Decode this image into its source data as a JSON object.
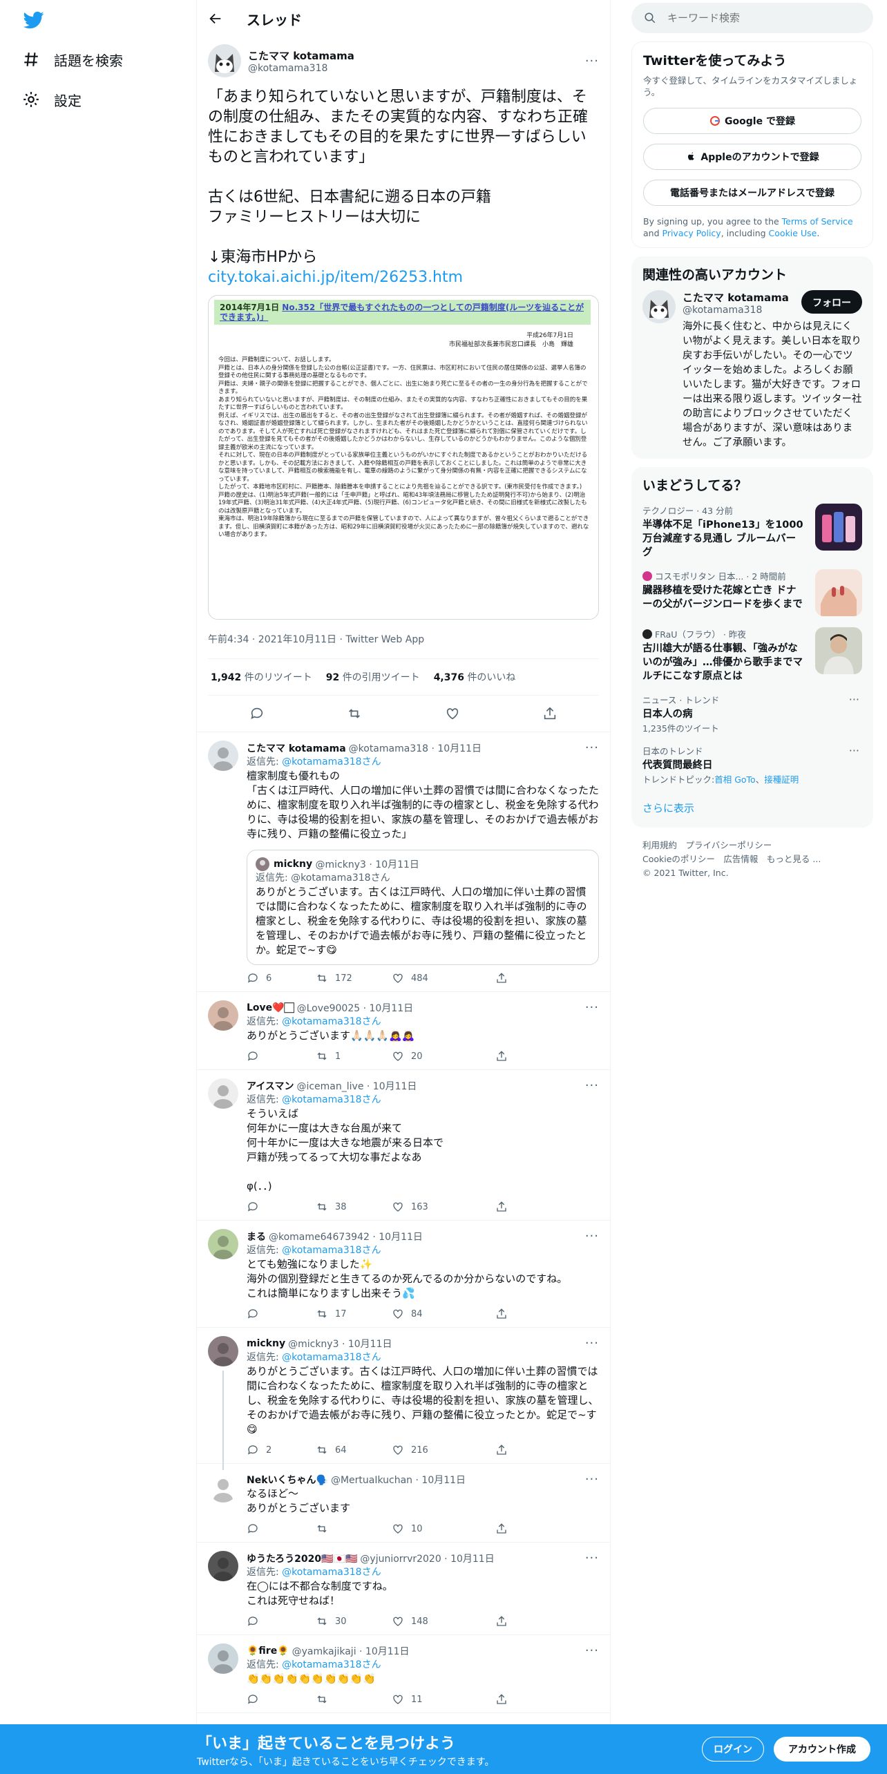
{
  "nav": {
    "explore": "話題を検索",
    "settings": "設定"
  },
  "header": {
    "title": "スレッド"
  },
  "focal": {
    "name": "こたママ kotamama",
    "handle": "@kotamama318",
    "text": "「あまり知られていないと思いますが、戸籍制度は、その制度の仕組み、またその実質的な内容、すなわち正確性におきましてもその目的を果たすに世界一すばらしいものと言われています」\n\n古くは6世紀、日本書紀に遡る日本の戸籍\nファミリーヒストリーは大切に\n\n↓東海市HPから",
    "link": "city.tokai.aichi.jp/item/26253.htm",
    "doc_banner_date": "2014年7月1日",
    "doc_banner_link": "No.352「世界で最もすぐれたものの一つとしての戸籍制度(ルーツを辿ることができます。)」",
    "doc_date": "平成26年7月1日",
    "doc_author": "市民福祉部次長兼市民窓口課長　小島　輝雄",
    "doc_body": "今回は、戸籍制度について、お話しします。\n戸籍とは、日本人の身分関係を登録した公の台帳(公正証書)です。一方、住民票は、市区町村において住民の居住関係の公証、選挙人名簿の登録その他住民に関する事務処理の基礎となるものです。\n戸籍は、夫婦・親子の関係を登録に把握することができ、個人ごとに、出生に始まり死亡に至るその者の一生の身分行為を把握することができます。\nあまり知られていないと思いますが、戸籍制度は、その制度の仕組み、またその実質的な内容、すなわち正確性におきましてもその目的を果たすに世界一すばらしいものと言われています。\n例えば、イギリスでは、出生の届出をすると、その者の出生登録がなされて出生登録簿に綴られます。その者が婚姻すれば、その婚姻登録がなされ、婚姻証書が婚姻登録簿として綴られます。しかし、生まれた者がその後婚姻したかどうかということは、直接何ら関連づけられないのであります。そして人が死亡すれば死亡登録がなされますけれども、それはまた死亡登録簿に綴られて別個に保管されていくだけです。したがって、出生登録を見てもその者がその後婚姻したかどうかはわからないし、生存しているのかどうかもわかりません。このような個別登録主義が欧米の主流になっています。\nそれに対して、現在の日本の戸籍制度がとっている家族単位主義というものがいかにすぐれた制度であるかということがおわかりいただけるかと思います。しかも、その記載方法におきまして、入籍や除籍相互の戸籍を表示しておくことにしました。これは簡単のようで非常に大きな意味を持っていまして、戸籍相互の検索機能を有し、電車の線路のように繋がって身分関係の有無・内容を正確に把握できるシステムになっています。\nしたがって、本籍地市区町村に、戸籍謄本、除籍謄本を申請することにより先祖を辿ることができる訳です。(東市民受付を作成できます。)\n戸籍の歴史は、(1)明治5年式戸籍(一般的には「壬申戸籍」と呼ばれ、昭和43年頃法務局に移管したため証明発行不可)から始まり、(2)明治19年式戸籍、(3)明治31年式戸籍、(4)大正4年式戸籍、(5)現行戸籍、(6)コンピュータ化戸籍と続き、その間に旧様式を新様式に改製したものは改製原戸籍となっています。\n東海市は、明治19年除籍簿から現在に至るまでの戸籍を保管していますので、人によって異なりますが、曾々祖父くらいまで遡ることができます。但し、旧横須賀町に本籍があった方は、昭和29年に旧横須賀町役場が火災にあったために一部の除籍簿が焼失していますので、遡れない場合があります。",
    "timestamp": "午前4:34 · 2021年10月11日 · Twitter Web App",
    "retweets_num": "1,942",
    "retweets_label": "件のリツイート",
    "quotes_num": "92",
    "quotes_label": "件の引用ツイート",
    "likes_num": "4,376",
    "likes_label": "件のいいね"
  },
  "replies": [
    {
      "name": "こたママ kotamama",
      "meta": "@kotamama318 · 10月11日",
      "replyto_prefix": "返信先: ",
      "replyto": "@kotamama318さん",
      "text": "檀家制度も優れもの\n「古くは江戸時代、人口の増加に伴い土葬の習慣では間に合わなくなったために、檀家制度を取り入れ半ば強制的に寺の檀家とし、税金を免除する代わりに、寺は役場的役割を担い、家族の墓を管理し、そのおかげで過去帳がお寺に残り、戸籍の整備に役立った」",
      "quote": {
        "name": "mickny",
        "meta": "@mickny3 · 10月11日",
        "replyto": "返信先: @kotamama318さん",
        "text": "ありがとうございます。古くは江戸時代、人口の増加に伴い土葬の習慣では間に合わなくなったために、檀家制度を取り入れ半ば強制的に寺の檀家とし、税金を免除する代わりに、寺は役場的役割を担い、家族の墓を管理し、そのおかげで過去帳がお寺に残り、戸籍の整備に役立ったとか。蛇足で~す😋"
      },
      "replies": "6",
      "retweets": "172",
      "likes": "484"
    },
    {
      "name": "Love❤️🏻",
      "meta": "@Love90025 · 10月11日",
      "replyto_prefix": "返信先: ",
      "replyto": "@kotamama318さん",
      "text": "ありがとうございます🙏🏻🙏🏻🙏🏻🙇‍♀️🙇‍♀️",
      "replies": "",
      "retweets": "1",
      "likes": "20"
    },
    {
      "name": "アイスマン",
      "meta": "@iceman_live · 10月11日",
      "replyto_prefix": "返信先: ",
      "replyto": "@kotamama318さん",
      "text": "そういえば\n何年かに一度は大きな台風が来て\n何十年かに一度は大きな地震が来る日本で\n戸籍が残ってるって大切な事だよなあ\n\nφ(．．)",
      "replies": "",
      "retweets": "38",
      "likes": "163"
    },
    {
      "name": "まる",
      "meta": "@komame64673942 · 10月11日",
      "replyto_prefix": "返信先: ",
      "replyto": "@kotamama318さん",
      "text": "とても勉強になりました✨\n海外の個別登録だと生きてるのか死んでるのか分からないのですね。\nこれは簡単になりますし出来そう💦",
      "replies": "",
      "retweets": "17",
      "likes": "84"
    },
    {
      "name": "mickny",
      "meta": "@mickny3 · 10月11日",
      "replyto_prefix": "返信先: ",
      "replyto": "@kotamama318さん",
      "text": "ありがとうございます。古くは江戸時代、人口の増加に伴い土葬の習慣では間に合わなくなったために、檀家制度を取り入れ半ば強制的に寺の檀家とし、税金を免除する代わりに、寺は役場的役割を担い、家族の墓を管理し、そのおかげで過去帳がお寺に残り、戸籍の整備に役立ったとか。蛇足で~す😋",
      "replies": "2",
      "retweets": "64",
      "likes": "216"
    },
    {
      "name": "Nekいくちゃん🗣️",
      "meta": "@MertuaIkuchan · 10月11日",
      "replyto_prefix": "",
      "replyto": "",
      "text": "なるほど〜\nありがとうございます",
      "replies": "",
      "retweets": "",
      "likes": "10"
    },
    {
      "name": "ゆうたろう2020🇺🇸🇯🇵🇺🇸",
      "meta": "@yjuniorrvr2020 · 10月11日",
      "replyto_prefix": "返信先: ",
      "replyto": "@kotamama318さん",
      "text": "在◯には不都合な制度ですね。\nこれは死守せねば！",
      "replies": "",
      "retweets": "30",
      "likes": "148"
    },
    {
      "name": "🌻fire🌻",
      "meta": "@yamkajikaji · 10月11日",
      "replyto_prefix": "返信先: ",
      "replyto": "@kotamama318さん",
      "text": "👏👏👏👏👏👏👏👏👏👏",
      "replies": "",
      "retweets": "",
      "likes": "11"
    }
  ],
  "right": {
    "search_placeholder": "キーワード検索",
    "signup_title": "Twitterを使ってみよう",
    "signup_sub": "今すぐ登録して、タイムラインをカスタマイズしましょう。",
    "google_btn": "Google で登録",
    "apple_btn": "Appleのアカウントで登録",
    "phone_btn": "電話番号またはメールアドレスで登録",
    "terms_1": "By signing up, you agree to the ",
    "terms_link1": "Terms of Service",
    "terms_2": " and ",
    "terms_link2": "Privacy Policy",
    "terms_3": ", including ",
    "terms_link3": "Cookie Use",
    "terms_4": ".",
    "related_title": "関連性の高いアカウント",
    "related_name": "こたママ kotamama",
    "related_handle": "@kotamama318",
    "related_follow": "フォロー",
    "related_bio": "海外に長く住むと、中からは見えにくい物がよく見えます。美しい日本を取り戻すお手伝いがしたい。その一心でツイッターを始めました。よろしくお願いいたします。猫が大好きです。フォローは出来る限り返します。ツイッター社の助言によりブロックさせていただく場合がありますが、深い意味はありません。ご了承願います。",
    "trends_title": "いまどうしてる？",
    "trends": [
      {
        "meta": "テクノロジー · 43 分前",
        "title": "半導体不足「iPhone13」を1000万台減産する見通し ブルームバーグ",
        "thumb": "phones"
      },
      {
        "meta": "コスモポリタン 日本... · 2 時間前",
        "title": "臓器移植を受けた花嫁と亡き ドナーの父がバージンロードを歩くまで",
        "thumb": "hands"
      },
      {
        "meta": "FRaU（フラウ） · 昨夜",
        "title": "古川雄大が語る仕事観、「強みがないのが強み」…俳優から歌手までマルチにこなす原点とは",
        "thumb": "portrait"
      }
    ],
    "trend_news_meta": "ニュース · トレンド",
    "trend_news_title": "日本人の病",
    "trend_news_count": "1,235件のツイート",
    "trend_jp_meta": "日本のトレンド",
    "trend_jp_title": "代表質問最終日",
    "trend_jp_topic_prefix": "トレンドトピック: ",
    "trend_jp_topic1": "首相 GoTo",
    "trend_jp_topic_sep": "、",
    "trend_jp_topic2": "接種証明",
    "show_more": "さらに表示",
    "footer1": "利用規約　プライバシーポリシー",
    "footer2": "Cookieのポリシー　広告情報　もっと見る ...",
    "footer3": "© 2021 Twitter, Inc."
  },
  "bottom": {
    "title": "「いま」起きていることを見つけよう",
    "sub": "Twitterなら、「いま」起きていることをいち早くチェックできます。",
    "login": "ログイン",
    "signup": "アカウント作成"
  },
  "colors": {
    "accent": "#1d9bf0",
    "text": "#0f1419",
    "secondary": "#536471"
  }
}
